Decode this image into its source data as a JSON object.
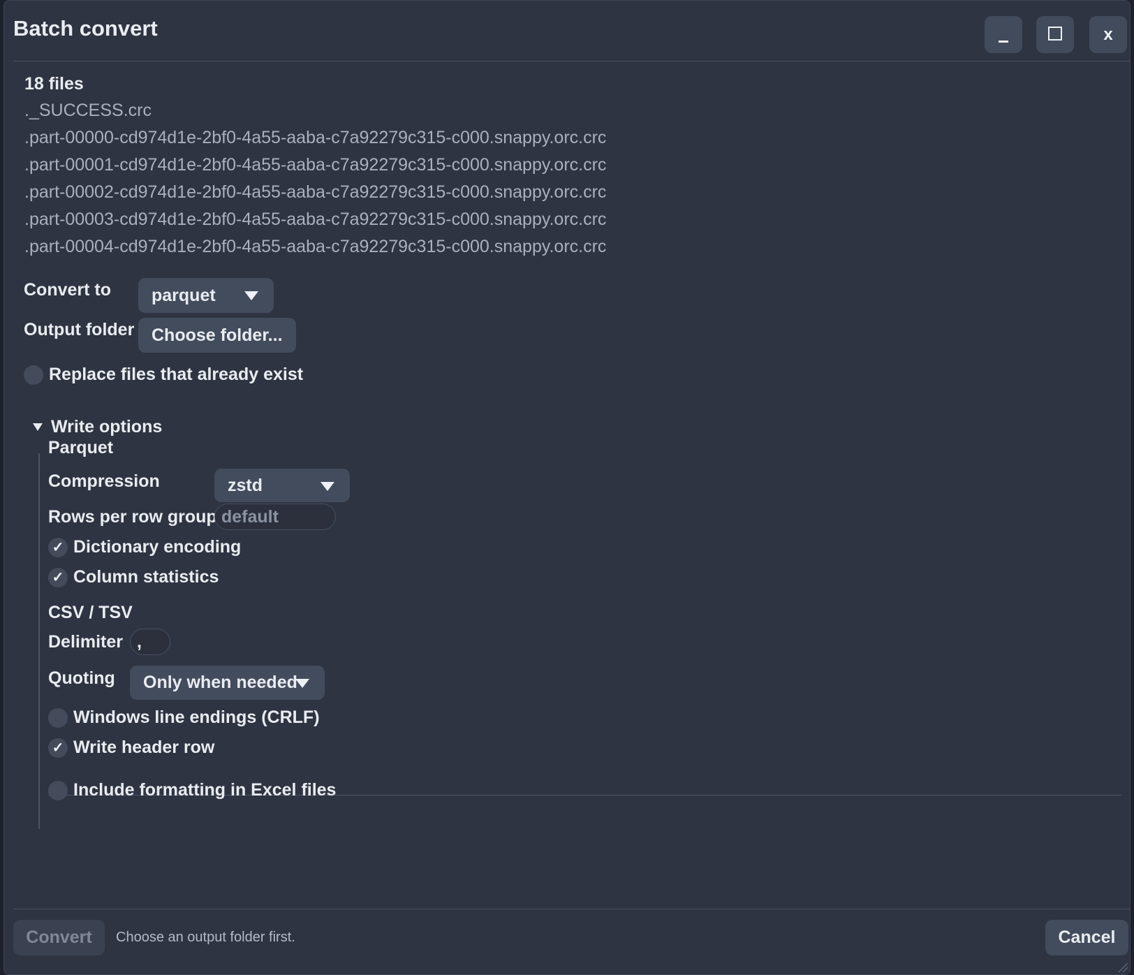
{
  "window": {
    "title": "Batch convert",
    "minimize_label": "_",
    "close_label": "x"
  },
  "files": {
    "count_label": "18 files",
    "items": [
      "._SUCCESS.crc",
      ".part-00000-cd974d1e-2bf0-4a55-aaba-c7a92279c315-c000.snappy.orc.crc",
      ".part-00001-cd974d1e-2bf0-4a55-aaba-c7a92279c315-c000.snappy.orc.crc",
      ".part-00002-cd974d1e-2bf0-4a55-aaba-c7a92279c315-c000.snappy.orc.crc",
      ".part-00003-cd974d1e-2bf0-4a55-aaba-c7a92279c315-c000.snappy.orc.crc",
      ".part-00004-cd974d1e-2bf0-4a55-aaba-c7a92279c315-c000.snappy.orc.crc"
    ]
  },
  "convert_to": {
    "label": "Convert to",
    "value": "parquet"
  },
  "output_folder": {
    "label": "Output folder",
    "button": "Choose folder..."
  },
  "replace_existing": {
    "label": "Replace files that already exist",
    "checked": false
  },
  "write_options": {
    "label": "Write options",
    "expanded": true,
    "parquet": {
      "title": "Parquet",
      "compression_label": "Compression",
      "compression_value": "zstd",
      "rows_per_group_label": "Rows per row group",
      "rows_per_group_placeholder": "default",
      "dictionary_encoding": {
        "label": "Dictionary encoding",
        "checked": true
      },
      "column_statistics": {
        "label": "Column statistics",
        "checked": true
      }
    },
    "csv": {
      "title": "CSV / TSV",
      "delimiter_label": "Delimiter",
      "delimiter_value": ",",
      "quoting_label": "Quoting",
      "quoting_value": "Only when needed",
      "crlf": {
        "label": "Windows line endings (CRLF)",
        "checked": false
      },
      "header_row": {
        "label": "Write header row",
        "checked": true
      }
    },
    "excel_formatting": {
      "label": "Include formatting in Excel files",
      "checked": false
    }
  },
  "footer": {
    "convert_label": "Convert",
    "hint": "Choose an output folder first.",
    "cancel_label": "Cancel"
  },
  "check_glyph": "✓"
}
